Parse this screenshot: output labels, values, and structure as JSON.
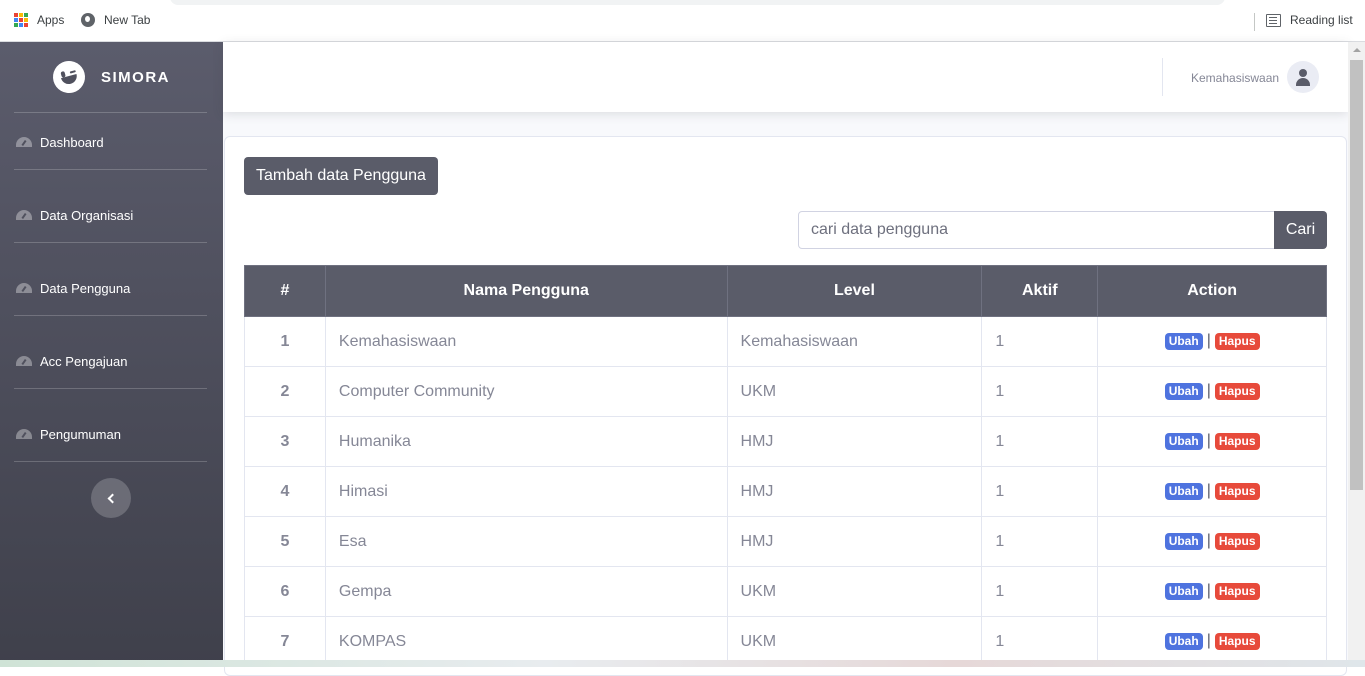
{
  "browser": {
    "bookmarks": [
      {
        "label": "Apps",
        "icon": "apps-grid-icon"
      },
      {
        "label": "New Tab",
        "icon": "globe-icon"
      }
    ],
    "reading_list": "Reading list"
  },
  "sidebar": {
    "brand": "SIMORA",
    "items": [
      {
        "label": "Dashboard",
        "icon": "dashboard-icon"
      },
      {
        "label": "Data Organisasi",
        "icon": "dashboard-icon"
      },
      {
        "label": "Data Pengguna",
        "icon": "dashboard-icon"
      },
      {
        "label": "Acc Pengajuan",
        "icon": "dashboard-icon"
      },
      {
        "label": "Pengumuman",
        "icon": "dashboard-icon"
      }
    ]
  },
  "topbar": {
    "user_name": "Kemahasiswaan"
  },
  "main": {
    "add_button": "Tambah data Pengguna",
    "search": {
      "placeholder": "cari data pengguna",
      "value": "",
      "button": "Cari"
    },
    "table": {
      "headers": [
        "#",
        "Nama Pengguna",
        "Level",
        "Aktif",
        "Action"
      ],
      "action_edit": "Ubah",
      "action_delete": "Hapus",
      "separator": "|",
      "rows": [
        {
          "no": "1",
          "nama": "Kemahasiswaan",
          "level": "Kemahasiswaan",
          "aktif": "1"
        },
        {
          "no": "2",
          "nama": "Computer Community",
          "level": "UKM",
          "aktif": "1"
        },
        {
          "no": "3",
          "nama": "Humanika",
          "level": "HMJ",
          "aktif": "1"
        },
        {
          "no": "4",
          "nama": "Himasi",
          "level": "HMJ",
          "aktif": "1"
        },
        {
          "no": "5",
          "nama": "Esa",
          "level": "HMJ",
          "aktif": "1"
        },
        {
          "no": "6",
          "nama": "Gempa",
          "level": "UKM",
          "aktif": "1"
        },
        {
          "no": "7",
          "nama": "KOMPAS",
          "level": "UKM",
          "aktif": "1"
        }
      ]
    }
  },
  "colors": {
    "sidebar": "#50515e",
    "primary_dark": "#5a5c69",
    "badge_edit": "#4e73df",
    "badge_delete": "#e74a3b",
    "text_muted": "#858796"
  }
}
